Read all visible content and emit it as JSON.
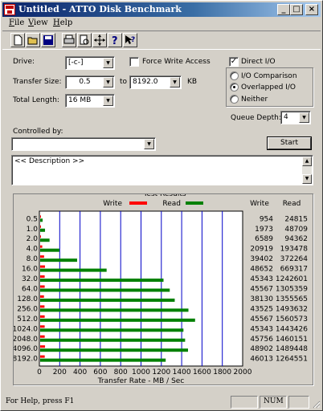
{
  "window": {
    "title": "Untitled - ATTO Disk Benchmark",
    "controls": [
      "_",
      "□",
      "×"
    ]
  },
  "menu": [
    {
      "hotkey": "F",
      "rest": "ile"
    },
    {
      "hotkey": "V",
      "rest": "iew"
    },
    {
      "hotkey": "H",
      "rest": "elp"
    }
  ],
  "toolbar": {
    "icons": [
      "new-file-icon",
      "open-folder-icon",
      "save-icon",
      "print-icon",
      "print-preview-icon",
      "move-icon",
      "help-icon",
      "context-help-icon"
    ]
  },
  "settings": {
    "drive_label": "Drive:",
    "drive_value": "[-c-]",
    "transfer_size_label": "Transfer Size:",
    "transfer_from": "0.5",
    "to_label": "to",
    "transfer_to": "8192.0",
    "kb_label": "KB",
    "total_length_label": "Total Length:",
    "total_length_value": "16 MB",
    "force_write_label": "Force Write Access",
    "force_write_checked": false,
    "direct_io_label": "Direct I/O",
    "direct_io_checked": true,
    "io_comparison_label": "I/O Comparison",
    "overlapped_label": "Overlapped I/O",
    "neither_label": "Neither",
    "selected_mode": "overlapped",
    "queue_depth_label": "Queue Depth:",
    "queue_depth_value": "4",
    "controlled_by_label": "Controlled by:",
    "controlled_by_value": "",
    "start_label": "Start",
    "description": "<< Description >>"
  },
  "chart_data": {
    "type": "bar",
    "title": "Test Results",
    "legend": [
      {
        "name": "Write",
        "color": "#ff0000"
      },
      {
        "name": "Read",
        "color": "#008000"
      }
    ],
    "xlabel": "Transfer Rate - MB / Sec",
    "xlim": [
      0,
      2000
    ],
    "xticks": [
      0,
      200,
      400,
      600,
      800,
      1000,
      1200,
      1400,
      1600,
      1800,
      2000
    ],
    "categories": [
      "0.5",
      "1.0",
      "2.0",
      "4.0",
      "8.0",
      "16.0",
      "32.0",
      "64.0",
      "128.0",
      "256.0",
      "512.0",
      "1024.0",
      "2048.0",
      "4096.0",
      "8192.0"
    ],
    "column_headers": [
      "Write",
      "Read"
    ],
    "series": [
      {
        "name": "Write",
        "color": "#ff0000",
        "values": [
          954,
          1973,
          6589,
          20919,
          39402,
          48652,
          45343,
          45567,
          38130,
          43525,
          45567,
          45343,
          45756,
          48902,
          46013
        ]
      },
      {
        "name": "Read",
        "color": "#008000",
        "values": [
          24815,
          48709,
          94362,
          193478,
          372264,
          669317,
          1242601,
          1305359,
          1355565,
          1493632,
          1560573,
          1443426,
          1460151,
          1489448,
          1264551
        ]
      }
    ]
  },
  "status": {
    "help_text": "For Help, press F1",
    "num_label": "NUM"
  }
}
